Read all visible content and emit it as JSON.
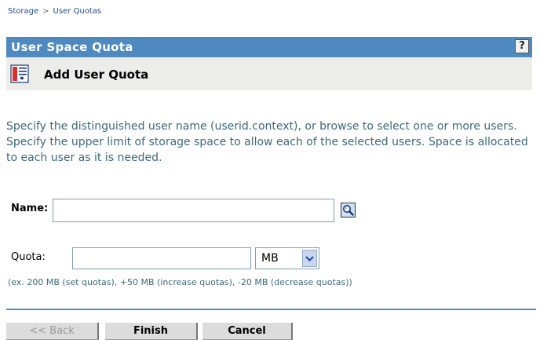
{
  "breadcrumb": {
    "items": [
      "Storage",
      "User Quotas"
    ],
    "separator": ">"
  },
  "header": {
    "title": "User Space Quota",
    "help_label": "?",
    "background_color": "#4e89c0"
  },
  "subheader": {
    "title": "Add User Quota",
    "icon": "form-icon"
  },
  "description": "Specify the distinguished user name (userid.context), or browse to select one or more users. Specify the upper limit of storage space to allow each of the selected users. Space is allocated to each user as it is needed.",
  "name_field": {
    "label": "Name:",
    "value": "",
    "browse_icon": "magnifier-icon"
  },
  "quota_field": {
    "label": "Quota:",
    "value": "",
    "unit": "MB",
    "hint": "(ex. 200 MB (set quotas), +50 MB (increase quotas), -20 MB (decrease quotas))"
  },
  "buttons": {
    "back": "<< Back",
    "finish": "Finish",
    "cancel": "Cancel"
  }
}
